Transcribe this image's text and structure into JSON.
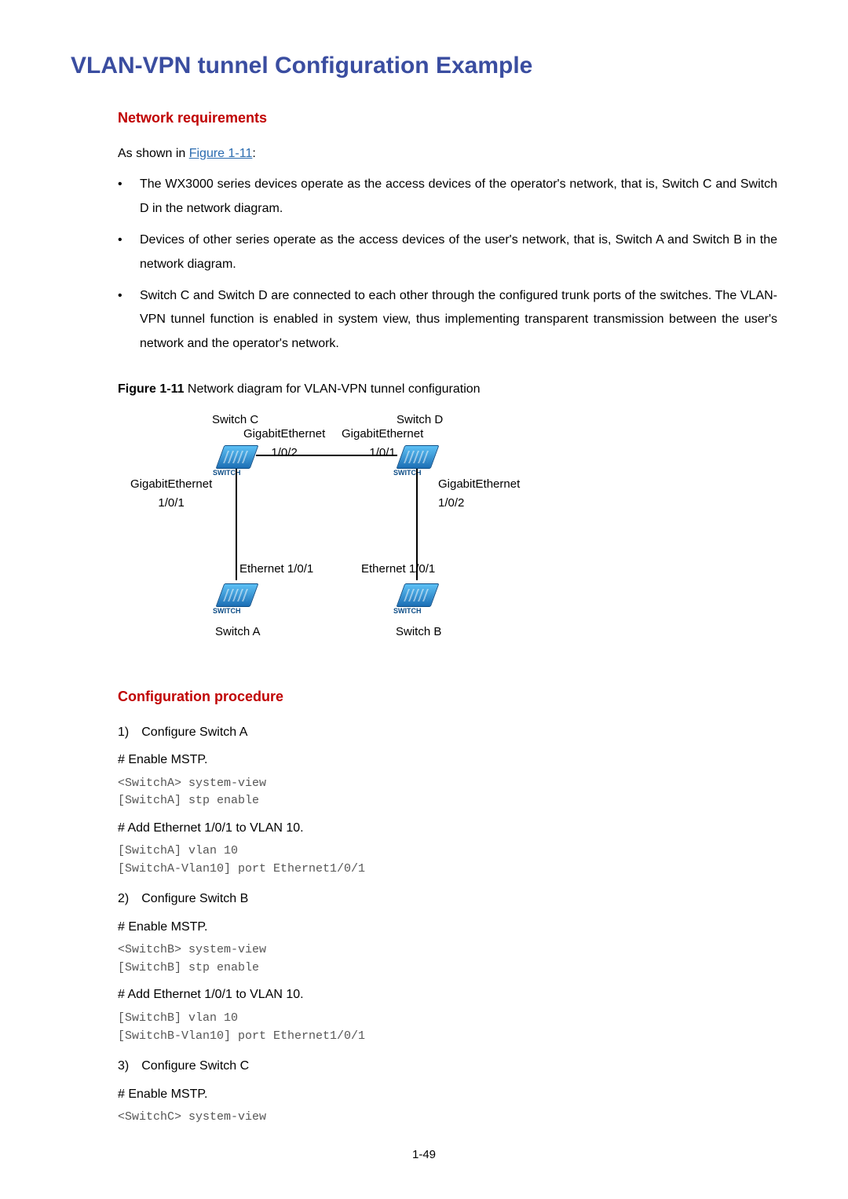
{
  "title": "VLAN-VPN tunnel Configuration Example",
  "section_req": "Network requirements",
  "intro_prefix": "As shown in ",
  "intro_link": "Figure 1-11",
  "intro_suffix": ":",
  "bullets": [
    "The WX3000 series devices operate as the access devices of the operator's network, that is, Switch C and Switch D in the network diagram.",
    "Devices of other series operate as the access devices of the user's network, that is, Switch A and Switch B in the network diagram.",
    "Switch C and Switch D are connected to each other through the configured trunk ports of the switches. The VLAN-VPN tunnel function is enabled in system view, thus implementing transparent transmission between the user's network and the operator's network."
  ],
  "figure_num": "Figure 1-11",
  "figure_caption": " Network diagram for VLAN-VPN tunnel configuration",
  "diagram": {
    "switch_c": "Switch C",
    "switch_d": "Switch D",
    "switch_a": "Switch A",
    "switch_b": "Switch B",
    "ge_102_c": "GigabitEthernet\n1/0/2",
    "ge_101_d": "GigabitEthernet\n1/0/1",
    "ge_101_c": "GigabitEthernet\n1/0/1",
    "ge_102_d": "GigabitEthernet\n1/0/2",
    "eth_101_a": "Ethernet 1/0/1",
    "eth_101_b": "Ethernet 1/0/1"
  },
  "section_proc": "Configuration procedure",
  "steps": [
    {
      "num": "1)",
      "label": "Configure Switch A",
      "blocks": [
        {
          "hash": "# Enable MSTP.",
          "code": "<SwitchA> system-view\n[SwitchA] stp enable"
        },
        {
          "hash": "# Add Ethernet 1/0/1 to VLAN 10.",
          "code": "[SwitchA] vlan 10\n[SwitchA-Vlan10] port Ethernet1/0/1"
        }
      ]
    },
    {
      "num": "2)",
      "label": "Configure Switch B",
      "blocks": [
        {
          "hash": "# Enable MSTP.",
          "code": "<SwitchB> system-view\n[SwitchB] stp enable"
        },
        {
          "hash": "# Add Ethernet 1/0/1 to VLAN 10.",
          "code": "[SwitchB] vlan 10\n[SwitchB-Vlan10] port Ethernet1/0/1"
        }
      ]
    },
    {
      "num": "3)",
      "label": "Configure Switch C",
      "blocks": [
        {
          "hash": "# Enable MSTP.",
          "code": "<SwitchC> system-view"
        }
      ]
    }
  ],
  "page_number": "1-49"
}
